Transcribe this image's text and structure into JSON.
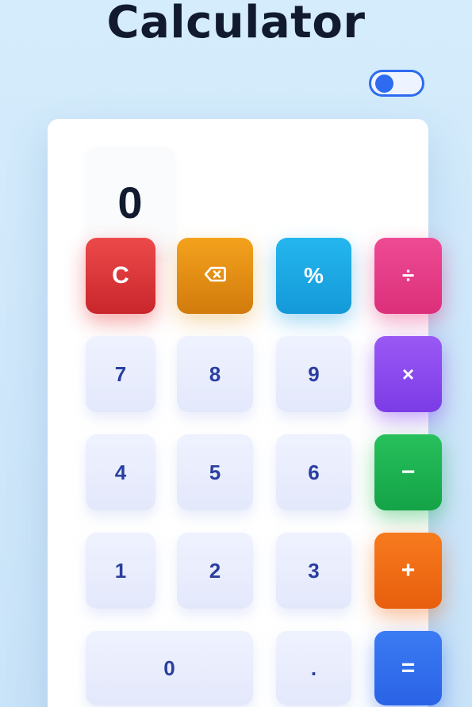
{
  "app": {
    "title": "Calculator"
  },
  "theme_toggle": {
    "state": "off"
  },
  "display": {
    "value": "0"
  },
  "keys": {
    "clear": "C",
    "backspace_icon": "backspace-icon",
    "percent": "%",
    "divide": "÷",
    "seven": "7",
    "eight": "8",
    "nine": "9",
    "multiply": "×",
    "four": "4",
    "five": "5",
    "six": "6",
    "subtract": "−",
    "one": "1",
    "two": "2",
    "three": "3",
    "add": "+",
    "zero": "0",
    "decimal": ".",
    "equals": "="
  },
  "colors": {
    "clear": "#d93636",
    "backspace": "#e69017",
    "percent": "#1ea8e4",
    "divide": "#e63d88",
    "multiply": "#8a4aef",
    "subtract": "#1cb152",
    "add": "#f06d16",
    "equals": "#326eec",
    "number_text": "#2a3ea0",
    "toggle_accent": "#2e6bf0"
  }
}
